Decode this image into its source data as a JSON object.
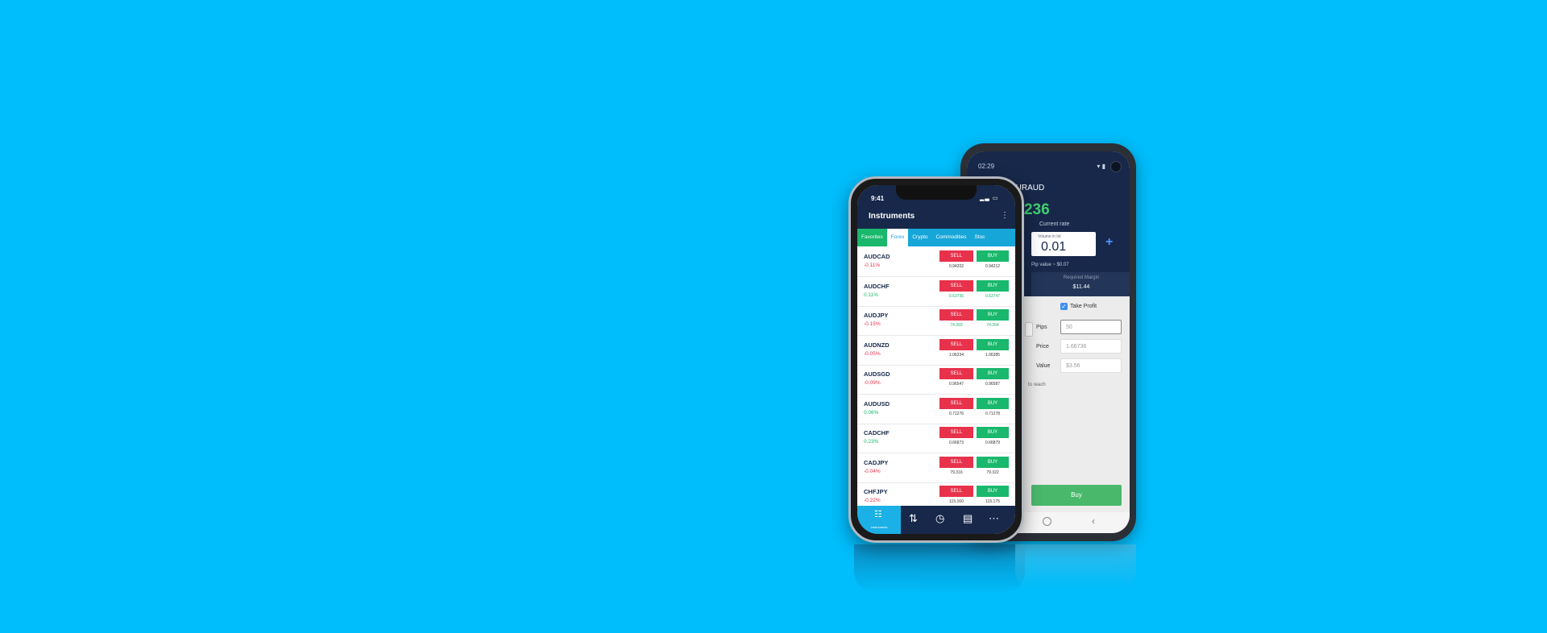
{
  "colors": {
    "background": "#00bdfb",
    "buy": "#19b86c",
    "sell": "#e8324b",
    "header": "#17284a"
  },
  "android": {
    "status_time": "02:29",
    "title": "EURAUD",
    "rate": "1.66236",
    "rate_label": "Current rate",
    "volume_label": "Volume in lot",
    "volume": "0.01",
    "pip_value": "Pip value ~ $0.07",
    "margin_label": "Required Margin",
    "margin_value": "$11.44",
    "take_profit": "Take Profit",
    "pips_label": "Pips",
    "pips_value": "50",
    "price_label": "Price",
    "price_value": "1.66736",
    "value_label": "Value",
    "value_value": "$3.56",
    "reach_text": "to reach",
    "buy_label": "Buy"
  },
  "iphone": {
    "status_time": "9:41",
    "title": "Instruments",
    "tabs": [
      "Favorites",
      "Forex",
      "Crypto",
      "Commodities",
      "Stoc"
    ],
    "sell_label": "SELL",
    "buy_label": "BUY",
    "rows": [
      {
        "symbol": "AUDCAD",
        "change": "-0.11%",
        "sell": "0.94202",
        "buy": "0.94212"
      },
      {
        "symbol": "AUDCHF",
        "change": "0.11%",
        "sell": "0.63736",
        "buy": "0.63747"
      },
      {
        "symbol": "AUDJPY",
        "change": "-0.15%",
        "sell": "74.393",
        "buy": "74.394"
      },
      {
        "symbol": "AUDNZD",
        "change": "-0.05%",
        "sell": "1.06334",
        "buy": "1.06385"
      },
      {
        "symbol": "AUDSGD",
        "change": "-0.09%",
        "sell": "0.96547",
        "buy": "0.96587"
      },
      {
        "symbol": "AUDUSD",
        "change": "0.06%",
        "sell": "0.71276",
        "buy": "0.71278"
      },
      {
        "symbol": "CADCHF",
        "change": "0.23%",
        "sell": "0.66873",
        "buy": "0.66879"
      },
      {
        "symbol": "CADJPY",
        "change": "-0.04%",
        "sell": "79.316",
        "buy": "79.322"
      },
      {
        "symbol": "CHFJPY",
        "change": "-0.22%",
        "sell": "115.160",
        "buy": "115.175"
      }
    ],
    "nav_label": "Instruments"
  }
}
